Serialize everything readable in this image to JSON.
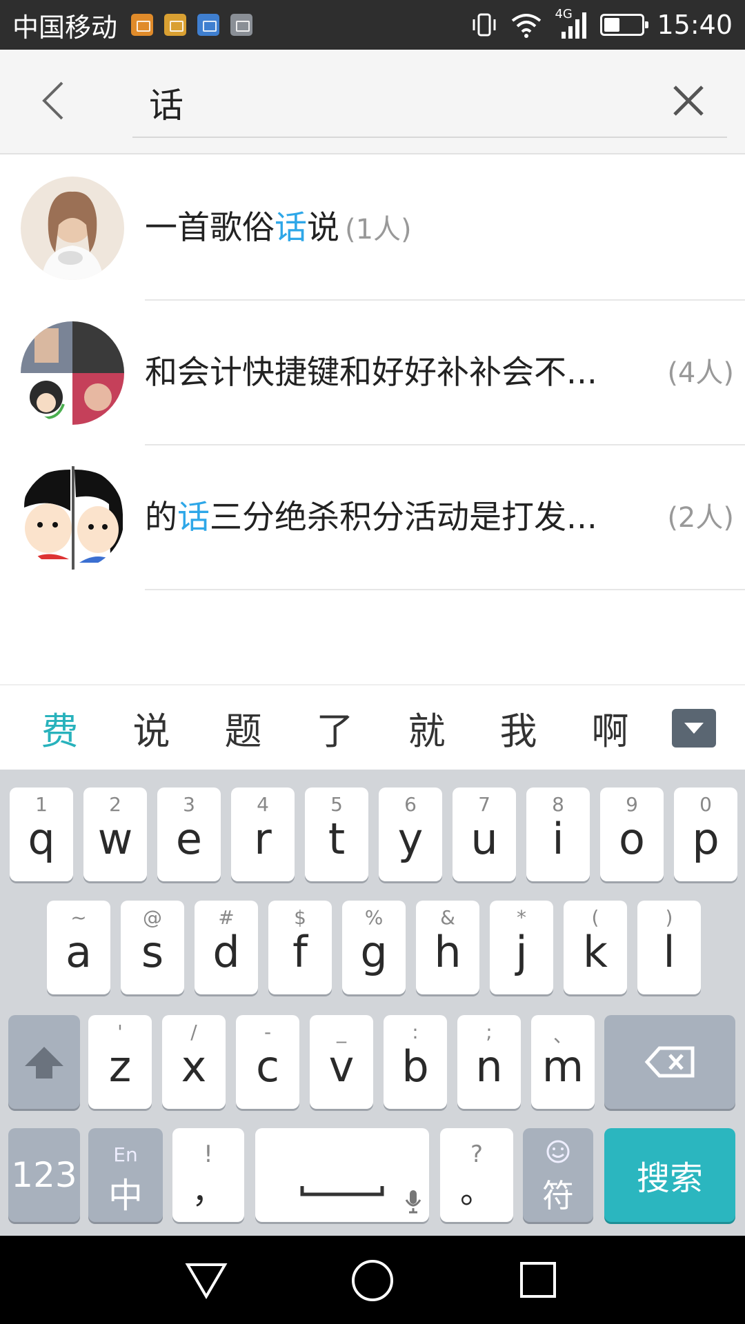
{
  "status_bar": {
    "carrier": "中国移动",
    "network": "4G",
    "time": "15:40",
    "notification_icons": [
      "uc-browser-icon",
      "keyboard-icon",
      "health-icon",
      "gallery-icon"
    ]
  },
  "search": {
    "query": "话",
    "back_icon": "back-arrow-icon",
    "clear_icon": "close-icon"
  },
  "results": [
    {
      "title_parts": [
        {
          "text": "一首歌俗",
          "highlight": false
        },
        {
          "text": "话",
          "highlight": true
        },
        {
          "text": "说",
          "highlight": false
        }
      ],
      "count": "(1人)",
      "count_inline": true
    },
    {
      "title_parts": [
        {
          "text": "和会计快捷键和好好补补会不...",
          "highlight": false
        }
      ],
      "count": "(4人)",
      "count_inline": false
    },
    {
      "title_parts": [
        {
          "text": "的",
          "highlight": false
        },
        {
          "text": "话",
          "highlight": true
        },
        {
          "text": "三分绝杀积分活动是打发...",
          "highlight": false
        }
      ],
      "count": "(2人)",
      "count_inline": false
    }
  ],
  "suggestions": [
    "费",
    "说",
    "题",
    "了",
    "就",
    "我",
    "啊"
  ],
  "keyboard": {
    "row1": [
      {
        "sub": "1",
        "main": "q"
      },
      {
        "sub": "2",
        "main": "w"
      },
      {
        "sub": "3",
        "main": "e"
      },
      {
        "sub": "4",
        "main": "r"
      },
      {
        "sub": "5",
        "main": "t"
      },
      {
        "sub": "6",
        "main": "y"
      },
      {
        "sub": "7",
        "main": "u"
      },
      {
        "sub": "8",
        "main": "i"
      },
      {
        "sub": "9",
        "main": "o"
      },
      {
        "sub": "0",
        "main": "p"
      }
    ],
    "row2": [
      {
        "sub": "~",
        "main": "a"
      },
      {
        "sub": "@",
        "main": "s"
      },
      {
        "sub": "#",
        "main": "d"
      },
      {
        "sub": "$",
        "main": "f"
      },
      {
        "sub": "%",
        "main": "g"
      },
      {
        "sub": "&",
        "main": "h"
      },
      {
        "sub": "*",
        "main": "j"
      },
      {
        "sub": "(",
        "main": "k"
      },
      {
        "sub": ")",
        "main": "l"
      }
    ],
    "row3": [
      {
        "sub": "'",
        "main": "z"
      },
      {
        "sub": "/",
        "main": "x"
      },
      {
        "sub": "-",
        "main": "c"
      },
      {
        "sub": "_",
        "main": "v"
      },
      {
        "sub": ":",
        "main": "b"
      },
      {
        "sub": ";",
        "main": "n"
      },
      {
        "sub": "、",
        "main": "m"
      }
    ],
    "numbers_label": "123",
    "lang_sub": "En",
    "lang_main": "中",
    "comma_sub": "!",
    "comma_main": "，",
    "period_sub": "?",
    "period_main": "。",
    "symbols_label": "符",
    "search_label": "搜索"
  },
  "colors": {
    "highlight": "#2ea7e8",
    "accent": "#2bb6bf"
  }
}
